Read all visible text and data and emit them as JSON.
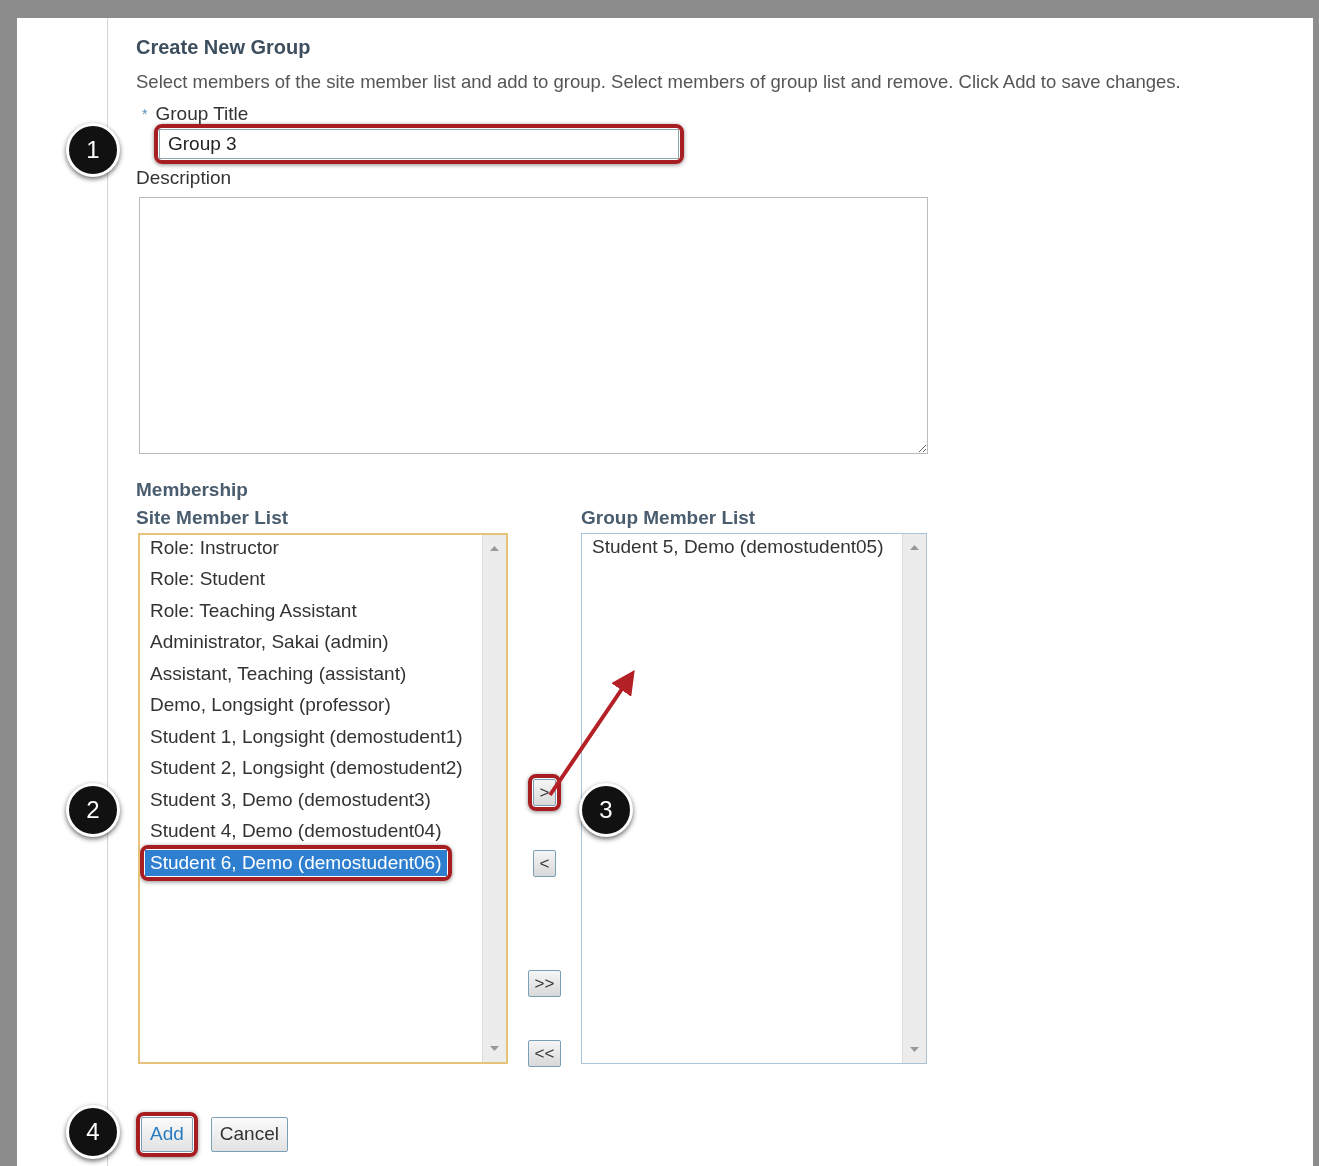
{
  "form": {
    "title": "Create New Group",
    "instructions": "Select members of the site member list and add to group. Select members of group list and remove. Click Add to save changes.",
    "title_field": {
      "required_mark": "*",
      "label": "Group Title",
      "value": "Group 3",
      "highlighted": true
    },
    "description": {
      "label": "Description"
    },
    "membership": {
      "heading": "Membership",
      "site_list": {
        "label": "Site Member List",
        "items": [
          {
            "text": "Role: Instructor",
            "selected": false,
            "highlighted": false
          },
          {
            "text": "Role: Student",
            "selected": false,
            "highlighted": false
          },
          {
            "text": "Role: Teaching Assistant",
            "selected": false,
            "highlighted": false
          },
          {
            "text": "Administrator, Sakai (admin)",
            "selected": false,
            "highlighted": false
          },
          {
            "text": "Assistant, Teaching (assistant)",
            "selected": false,
            "highlighted": false
          },
          {
            "text": "Demo, Longsight (professor)",
            "selected": false,
            "highlighted": false
          },
          {
            "text": "Student 1, Longsight (demostudent1)",
            "selected": false,
            "highlighted": false
          },
          {
            "text": "Student 2, Longsight (demostudent2)",
            "selected": false,
            "highlighted": false
          },
          {
            "text": "Student 3, Demo (demostudent3)",
            "selected": false,
            "highlighted": false
          },
          {
            "text": "Student 4, Demo (demostudent04)",
            "selected": false,
            "highlighted": false
          },
          {
            "text": "Student 6, Demo (demostudent06)",
            "selected": true,
            "highlighted": true
          }
        ]
      },
      "transfer_buttons": [
        {
          "label": ">",
          "highlighted": true
        },
        {
          "label": "<",
          "highlighted": false
        },
        {
          "label": ">>",
          "highlighted": false
        },
        {
          "label": "<<",
          "highlighted": false
        }
      ],
      "group_list": {
        "label": "Group Member List",
        "items": [
          {
            "text": "Student 5, Demo (demostudent05)",
            "selected": false,
            "highlighted": false
          }
        ]
      }
    },
    "buttons": [
      {
        "label": "Add",
        "kind": "primary",
        "highlighted": true
      },
      {
        "label": "Cancel",
        "kind": "secondary",
        "highlighted": false
      }
    ]
  },
  "callouts": [
    "1",
    "2",
    "3",
    "4"
  ]
}
